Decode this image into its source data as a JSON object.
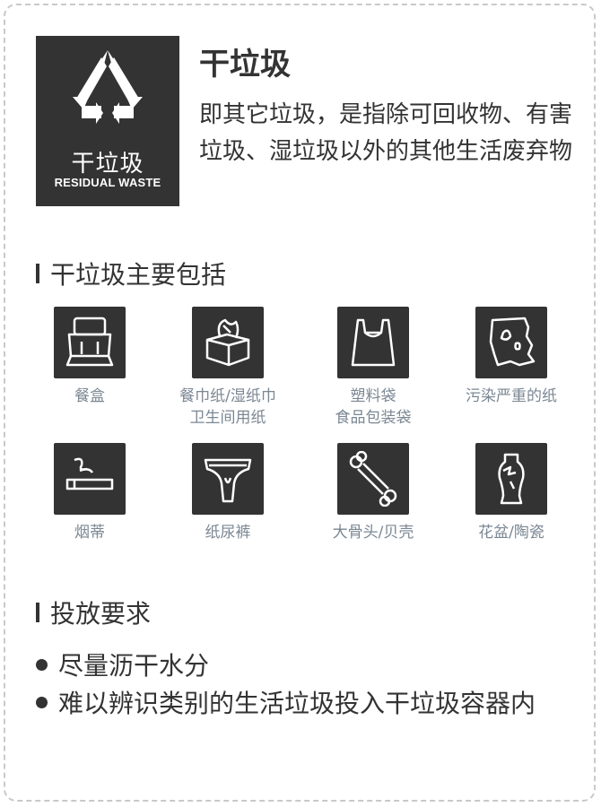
{
  "logo": {
    "label_zh": "干垃圾",
    "label_en": "RESIDUAL WASTE",
    "icon": "recycle-arrows-icon"
  },
  "title": "干垃圾",
  "description": "即其它垃圾，是指除可回收物、有害垃圾、湿垃圾以外的其他生活废弃物",
  "section_items": {
    "heading": "干垃圾主要包括"
  },
  "items": [
    {
      "lines": [
        "餐盒"
      ],
      "icon": "lunch-box-icon"
    },
    {
      "lines": [
        "餐巾纸/湿纸巾",
        "卫生间用纸"
      ],
      "icon": "tissue-box-icon"
    },
    {
      "lines": [
        "塑料袋",
        "食品包装袋"
      ],
      "icon": "plastic-bag-icon"
    },
    {
      "lines": [
        "污染严重的纸"
      ],
      "icon": "dirty-paper-icon"
    },
    {
      "lines": [
        "烟蒂"
      ],
      "icon": "cigarette-butt-icon"
    },
    {
      "lines": [
        "纸尿裤"
      ],
      "icon": "diaper-icon"
    },
    {
      "lines": [
        "大骨头/贝壳"
      ],
      "icon": "bone-icon"
    },
    {
      "lines": [
        "花盆/陶瓷"
      ],
      "icon": "broken-vase-icon"
    }
  ],
  "section_requirements": {
    "heading": "投放要求",
    "items": [
      "尽量沥干水分",
      "难以辨识类别的生活垃圾投入干垃圾容器内"
    ]
  },
  "colors": {
    "dark": "#333333",
    "label": "#7b8793",
    "border": "#c9c9c9"
  }
}
